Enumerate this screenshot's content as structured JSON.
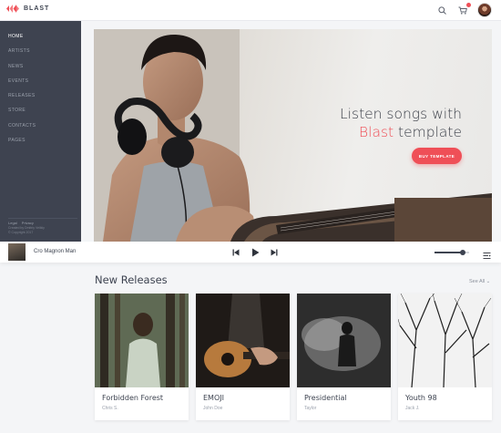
{
  "app": {
    "brand": "BLAST"
  },
  "header": {
    "search_icon": "search-icon",
    "cart_icon": "cart-icon",
    "avatar_icon": "user-avatar"
  },
  "sidebar": {
    "items": [
      {
        "label": "HOME",
        "active": true
      },
      {
        "label": "ARTISTS",
        "active": false
      },
      {
        "label": "NEWS",
        "active": false
      },
      {
        "label": "EVENTS",
        "active": false
      },
      {
        "label": "RELEASES",
        "active": false
      },
      {
        "label": "STORE",
        "active": false
      },
      {
        "label": "CONTACTS",
        "active": false
      },
      {
        "label": "PAGES",
        "active": false
      }
    ],
    "footer": {
      "links": [
        "Legal",
        "Privacy"
      ],
      "credit": "Created by Dmitriy Velikiy",
      "copyright": "© Copyright 2017"
    }
  },
  "hero": {
    "line1": "Listen songs with",
    "accent_word": "Blast",
    "line2_rest": " template",
    "button_label": "BUY TEMPLATE"
  },
  "player": {
    "track_title": "Cro Magnon Man",
    "volume_level": 0.82,
    "icons": [
      "skip-back-icon",
      "play-icon",
      "skip-forward-icon",
      "playlist-icon"
    ]
  },
  "releases": {
    "title": "New Releases",
    "see_all": "See All",
    "items": [
      {
        "title": "Forbidden Forest",
        "artist": "Chris S."
      },
      {
        "title": "EMOJI",
        "artist": "John Doe"
      },
      {
        "title": "Presidential",
        "artist": "Taylor"
      },
      {
        "title": "Youth 98",
        "artist": "Jack J."
      }
    ]
  },
  "colors": {
    "accent": "#ef4f57",
    "sidebar": "#3e4350",
    "text": "#3d4350"
  }
}
